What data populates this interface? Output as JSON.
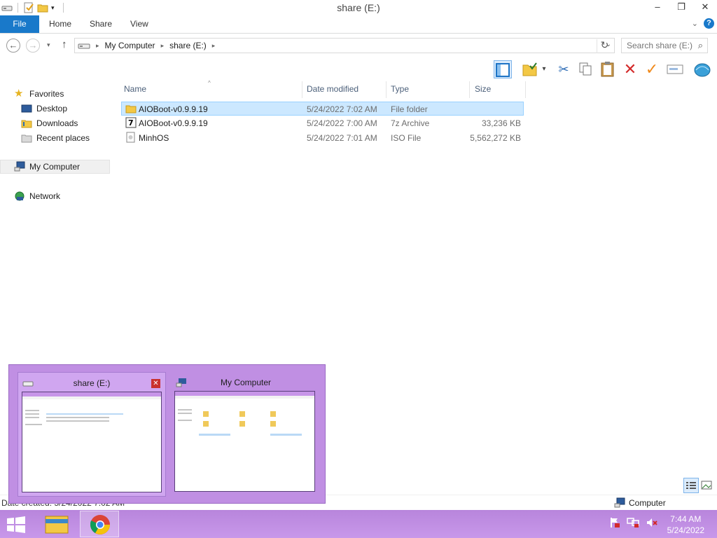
{
  "window": {
    "title": "share (E:)",
    "controls": {
      "minimize": "–",
      "restore": "❐",
      "close": "✕"
    }
  },
  "ribbon": {
    "tabs": [
      "File",
      "Home",
      "Share",
      "View"
    ]
  },
  "address": {
    "crumbs": [
      "My Computer",
      "share (E:)"
    ],
    "search_placeholder": "Search share (E:)"
  },
  "nav": {
    "favorites": "Favorites",
    "desktop": "Desktop",
    "downloads": "Downloads",
    "recent": "Recent places",
    "computer": "My Computer",
    "network": "Network"
  },
  "columns": {
    "name": "Name",
    "date": "Date modified",
    "type": "Type",
    "size": "Size"
  },
  "files": [
    {
      "name": "AIOBoot-v0.9.9.19",
      "date": "5/24/2022 7:02 AM",
      "type": "File folder",
      "size": ""
    },
    {
      "name": "AIOBoot-v0.9.9.19",
      "date": "5/24/2022 7:00 AM",
      "type": "7z Archive",
      "size": "33,236 KB"
    },
    {
      "name": "MinhOS",
      "date": "5/24/2022 7:01 AM",
      "type": "ISO File",
      "size": "5,562,272 KB"
    }
  ],
  "thumbnails": [
    {
      "title": "share (E:)"
    },
    {
      "title": "My Computer"
    }
  ],
  "status": {
    "text": "Date created: 5/24/2022 7:02 AM",
    "computer": "Computer"
  },
  "clock": {
    "time": "7:44 AM",
    "date": "5/24/2022"
  },
  "colors": {
    "accent": "#1979ca",
    "taskbar": "#c08fe3",
    "selection": "#cce8ff"
  }
}
